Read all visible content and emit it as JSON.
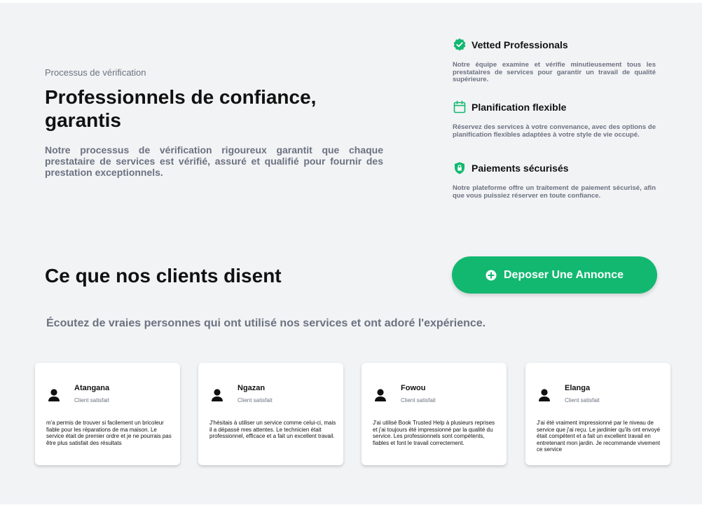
{
  "hero": {
    "eyebrow": "Processus de vérification",
    "title": "Professionnels de confiance, garantis",
    "description": "Notre processus de vérification rigoureux garantit que chaque prestataire de services est vérifié, assuré et qualifié pour fournir des prestation exceptionnels."
  },
  "features": [
    {
      "icon": "verified-badge-icon",
      "title": "Vetted Professionals",
      "description": "Notre équipe examine et vérifie minutieusement tous les prestataires de services pour garantir un travail de qualité supérieure."
    },
    {
      "icon": "calendar-icon",
      "title": "Planification flexible",
      "description": "Réservez des services à votre convenance, avec des options de planification flexibles adaptées à votre style de vie occupé."
    },
    {
      "icon": "lock-shield-icon",
      "title": "Paiements sécurisés",
      "description": "Notre plateforme offre un traitement de paiement sécurisé, afin que vous puissiez réserver en toute confiance."
    }
  ],
  "testimonials": {
    "title": "Ce que nos clients disent",
    "subtitle": "Écoutez de vraies personnes qui ont utilisé nos services et  ont adoré l'expérience.",
    "cta_label": "Deposer Une Annonce",
    "cta_icon": "plus-circle-icon",
    "cards": [
      {
        "name": "Atangana",
        "role": "Client satisfait",
        "text": "m'a permis de trouver si facilement un bricoleur fiable pour les réparations de ma maison. Le service était de premier ordre et je ne pourrais pas être plus satisfait des résultats"
      },
      {
        "name": "Ngazan",
        "role": "Client satisfait",
        "text": "J'hésitais à utiliser un service comme celui-ci, mais il a dépassé mes attentes. Le technicien était professionnel, efficace et a fait un excellent travail."
      },
      {
        "name": "Fowou",
        "role": "Client satisfait",
        "text": "J'ai utilisé Book Trusted Help à plusieurs reprises et j'ai toujours été impressionné par la qualité du service. Les professionnels sont compétents, fiables et font le travail correctement."
      },
      {
        "name": "Elanga",
        "role": "Client satisfait",
        "text": "J'ai été vraiment impressionné par le niveau de service que j'ai reçu. Le jardinier qu'ils ont envoyé était compétent et a fait un excellent travail en entretenant mon jardin. Je recommande vivement ce service"
      }
    ]
  },
  "colors": {
    "accent": "#12b870",
    "background": "#f2f3f5",
    "muted_text": "#6b7280"
  }
}
